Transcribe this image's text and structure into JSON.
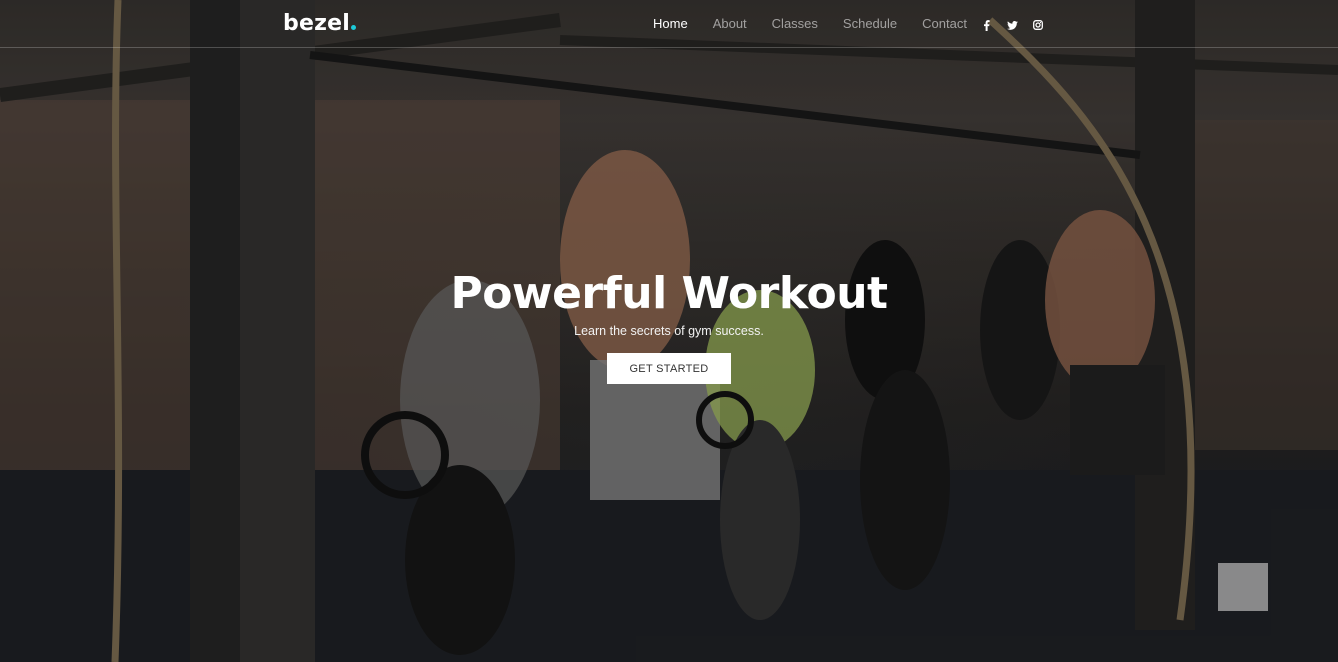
{
  "brand": {
    "name": "bezel",
    "dot_color": "#1ccad8"
  },
  "nav": {
    "items": [
      {
        "label": "Home",
        "active": true
      },
      {
        "label": "About",
        "active": false
      },
      {
        "label": "Classes",
        "active": false
      },
      {
        "label": "Schedule",
        "active": false
      },
      {
        "label": "Contact",
        "active": false
      }
    ],
    "social": [
      {
        "icon": "facebook-icon"
      },
      {
        "icon": "twitter-icon"
      },
      {
        "icon": "instagram-icon"
      }
    ]
  },
  "hero": {
    "title": "Powerful Workout",
    "subtitle": "Learn the secrets of gym success.",
    "cta_label": "GET STARTED",
    "background": "gym-workout-photo"
  }
}
